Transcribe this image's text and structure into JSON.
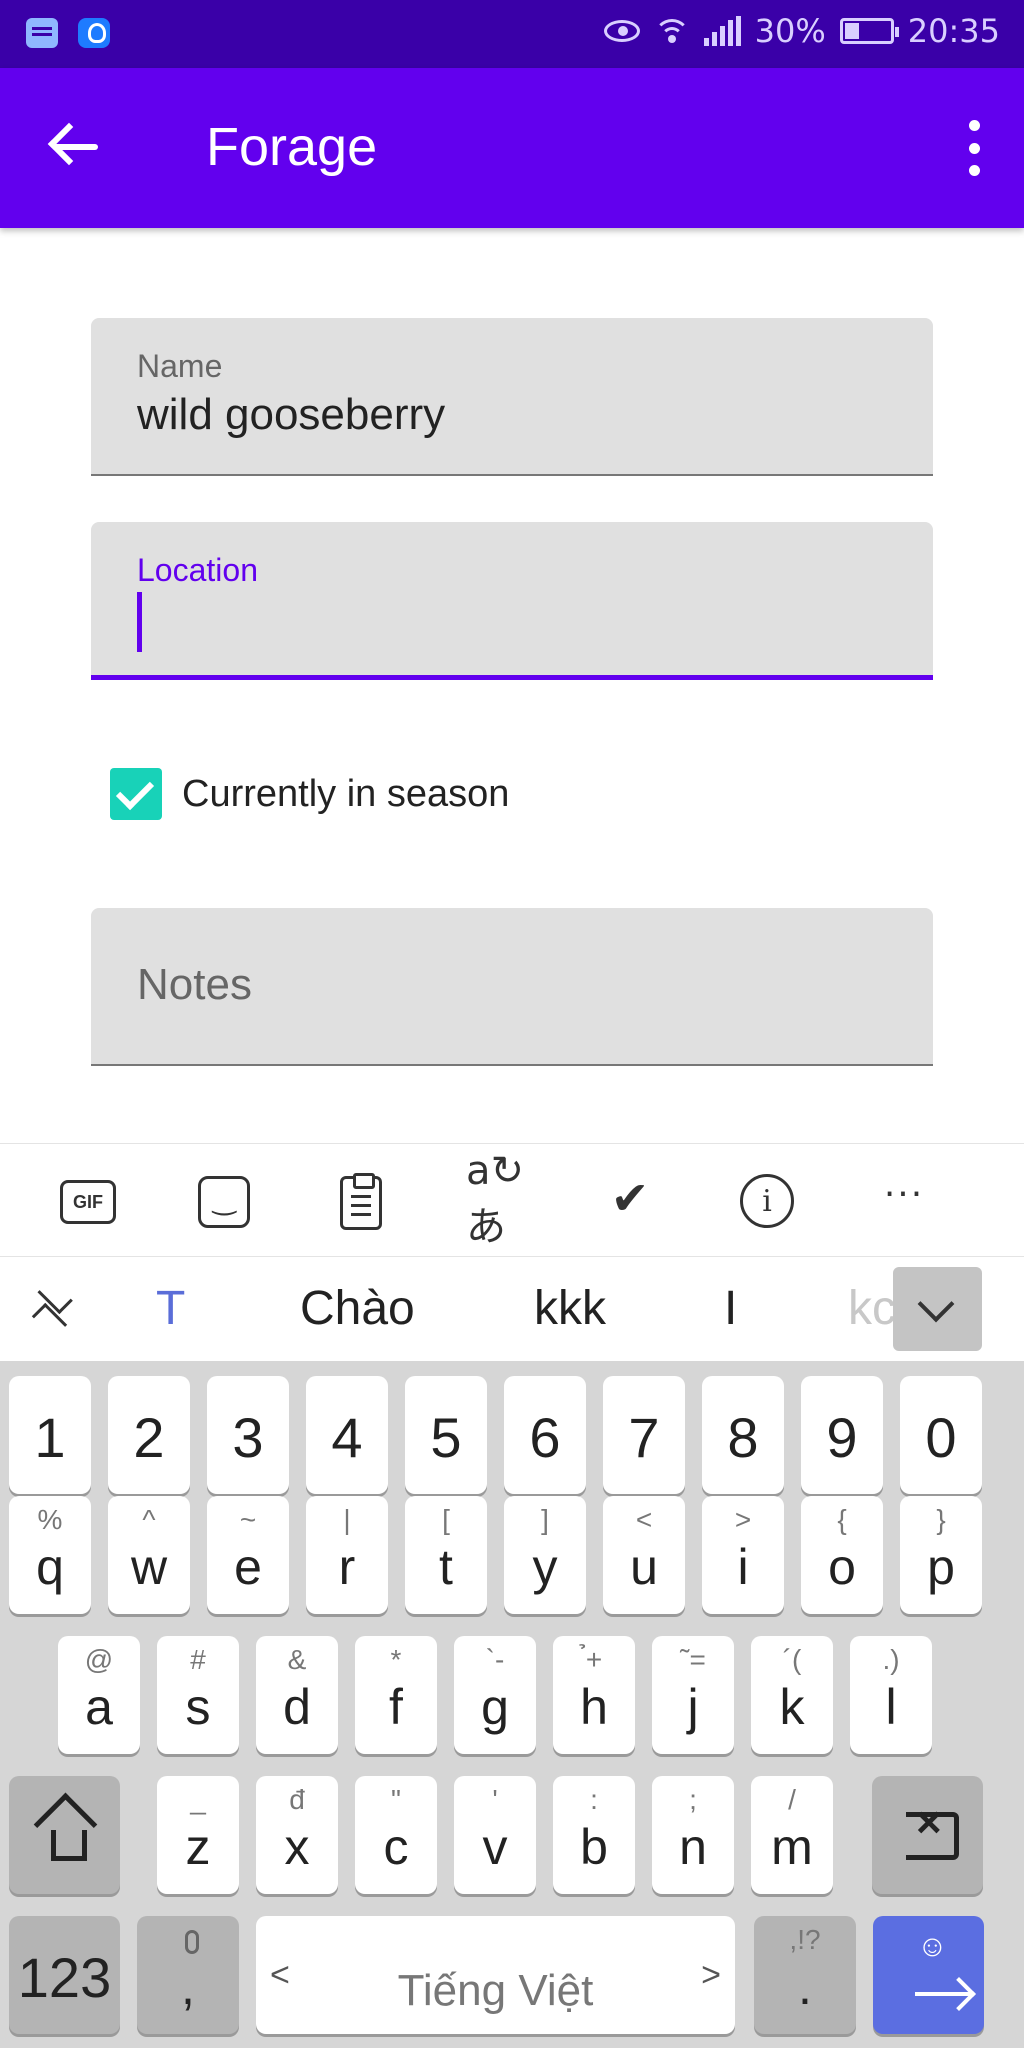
{
  "status_bar": {
    "battery_percent": "30%",
    "time": "20:35"
  },
  "app_bar": {
    "title": "Forage"
  },
  "form": {
    "name_label": "Name",
    "name_value": "wild gooseberry",
    "location_label": "Location",
    "location_value": "",
    "in_season_label": "Currently in season",
    "in_season_checked": true,
    "notes_placeholder": "Notes"
  },
  "keyboard_toolbar": {
    "gif_label": "GIF",
    "translate_glyph": "a↻あ",
    "more_glyph": "···"
  },
  "suggestions": [
    "T",
    "Chào",
    "kkk",
    "I",
    "kc"
  ],
  "keyboard": {
    "number_row": [
      "1",
      "2",
      "3",
      "4",
      "5",
      "6",
      "7",
      "8",
      "9",
      "0"
    ],
    "row1": [
      {
        "main": "q",
        "sub": "%"
      },
      {
        "main": "w",
        "sub": "^"
      },
      {
        "main": "e",
        "sub": "~"
      },
      {
        "main": "r",
        "sub": "|"
      },
      {
        "main": "t",
        "sub": "["
      },
      {
        "main": "y",
        "sub": "]"
      },
      {
        "main": "u",
        "sub": "<"
      },
      {
        "main": "i",
        "sub": ">"
      },
      {
        "main": "o",
        "sub": "{"
      },
      {
        "main": "p",
        "sub": "}"
      }
    ],
    "row2": [
      {
        "main": "a",
        "sub": "@"
      },
      {
        "main": "s",
        "sub": "#"
      },
      {
        "main": "d",
        "sub": "&"
      },
      {
        "main": "f",
        "sub": "*"
      },
      {
        "main": "g",
        "sub": "`-"
      },
      {
        "main": "h",
        "sub": "̉+"
      },
      {
        "main": "j",
        "sub": "˜="
      },
      {
        "main": "k",
        "sub": "´("
      },
      {
        "main": "l",
        "sub": ".)"
      }
    ],
    "row3": [
      {
        "main": "z",
        "sub": "_"
      },
      {
        "main": "x",
        "sub": "đ"
      },
      {
        "main": "c",
        "sub": "\""
      },
      {
        "main": "v",
        "sub": "'"
      },
      {
        "main": "b",
        "sub": ":"
      },
      {
        "main": "n",
        "sub": ";"
      },
      {
        "main": "m",
        "sub": "/"
      }
    ],
    "numbers_key": "123",
    "comma_key": ",",
    "space_label": "Tiếng Việt",
    "space_left": "<",
    "space_right": ">",
    "period_key": ".",
    "period_sub": ",!?",
    "enter_emoji": "☺"
  },
  "colors": {
    "status_bar": "#3a00a8",
    "app_bar": "#6200ee",
    "checkbox": "#18d2b8",
    "enter_key": "#5b6ee1"
  }
}
